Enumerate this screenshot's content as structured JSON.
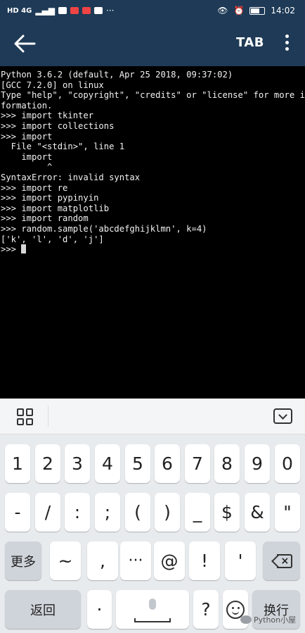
{
  "status_bar": {
    "left_indicators": "HD 4G",
    "time": "14:02"
  },
  "app_bar": {
    "tab_label": "TAB"
  },
  "terminal": {
    "lines": [
      "Python 3.6.2 (default, Apr 25 2018, 09:37:02)",
      "[GCC 7.2.0] on linux",
      "Type \"help\", \"copyright\", \"credits\" or \"license\" for more in",
      "formation.",
      ">>> import tkinter",
      ">>> import collections",
      ">>> import",
      "  File \"<stdin>\", line 1",
      "    import",
      "         ^",
      "SyntaxError: invalid syntax",
      ">>> import re",
      ">>> import pypinyin",
      ">>> import matplotlib",
      ">>> import random",
      ">>> random.sample('abcdefghijklmn', k=4)",
      "['k', 'l', 'd', 'j']"
    ],
    "prompt": ">>> "
  },
  "keyboard": {
    "row1": [
      "1",
      "2",
      "3",
      "4",
      "5",
      "6",
      "7",
      "8",
      "9",
      "0"
    ],
    "row2": [
      "-",
      "/",
      ":",
      ";",
      "(",
      ")",
      "_",
      "$",
      "&",
      "\""
    ],
    "row3": {
      "more_label": "更多",
      "keys": [
        "~",
        ",",
        "···",
        "@",
        "!",
        "'"
      ]
    },
    "row4": {
      "back_label": "返回",
      "dot": "·",
      "question": "?",
      "enter_label": "换行"
    }
  },
  "watermark": "Python小屋",
  "colors": {
    "header_bg": "#1e3a56",
    "terminal_bg": "#000000",
    "keyboard_bg": "#e8ebee"
  }
}
